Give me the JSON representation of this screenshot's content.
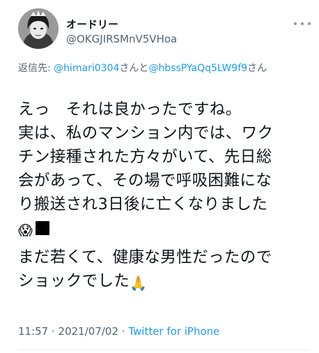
{
  "user": {
    "display_name": "オードリー",
    "handle": "@OKGJIRSMnV5VHoa"
  },
  "reply": {
    "prefix": "返信先: ",
    "mention_1": "@himari0304",
    "connector": "さんと",
    "mention_2": "@hbssPYaQq5LW9f9",
    "suffix": "さん"
  },
  "tweet": {
    "lines": [
      "えっ　それは良かったですね。",
      "実は、私のマンション内では、ワク",
      "チン接種された方々がいて、先日総",
      "会があって、その場で呼吸困難にな",
      "り搬送され3日後に亡くなりました"
    ],
    "emoji_line_1": "😱",
    "line_after_gap_1": "まだ若くて、健康な男性だったので",
    "line_after_gap_2": "ショックでした",
    "emoji_line_2": "🙏"
  },
  "meta": {
    "time": "11:57",
    "separator": " · ",
    "date": "2021/07/02",
    "source": "Twitter for iPhone"
  },
  "icons": [
    "avatar",
    "more-icon",
    "scream-emoji",
    "black-square",
    "pray-emoji"
  ]
}
